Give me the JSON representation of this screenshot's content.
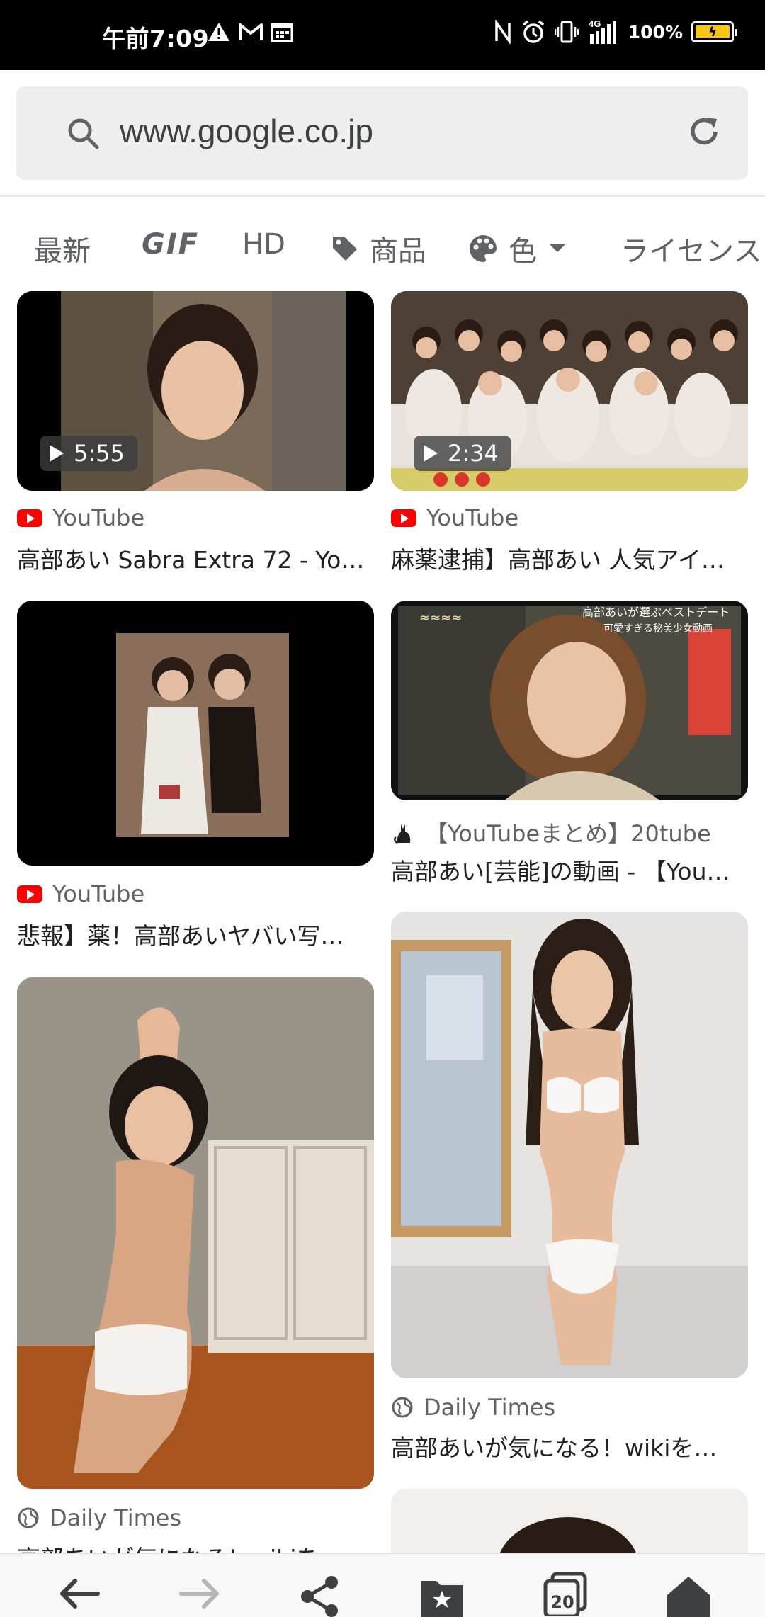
{
  "status_bar": {
    "time": "午前7:09",
    "network": "4G",
    "battery_pct": "100%",
    "battery_level": 1.0,
    "icons": [
      "warning-icon",
      "gmail-icon",
      "calendar-icon",
      "nfc-icon",
      "alarm-icon",
      "vibrate-icon",
      "signal-icon",
      "battery-icon"
    ]
  },
  "browser": {
    "url": "www.google.co.jp",
    "icons": [
      "search-icon",
      "reload-icon"
    ]
  },
  "filters": [
    {
      "label": "最新",
      "icon": ""
    },
    {
      "label": "GIF",
      "icon": ""
    },
    {
      "label": "HD",
      "icon": ""
    },
    {
      "label": "商品",
      "icon": "tag-icon"
    },
    {
      "label": "色",
      "icon": "palette-icon"
    },
    {
      "label": "ライセンス",
      "icon": ""
    }
  ],
  "results": [
    {
      "duration": "5:55",
      "source": "YouTube",
      "source_icon": "youtube-icon",
      "title": "高部あい Sabra Extra 72 - You…"
    },
    {
      "duration": "2:34",
      "source": "YouTube",
      "source_icon": "youtube-icon",
      "title": "麻薬逮捕】高部あい 人気アイ…"
    },
    {
      "duration": "",
      "source": "YouTube",
      "source_icon": "youtube-icon",
      "title": "悲報】薬！高部あいヤバい写…"
    },
    {
      "duration": "",
      "source": "【YouTubeまとめ】20tube",
      "source_icon": "cat-icon",
      "title": "高部あい[芸能]の動画 - 【You…",
      "overlay_line1": "高部あいが選ぶベストデート",
      "overlay_line2": "可愛すぎる秘美少女動画"
    },
    {
      "duration": "",
      "source": "Daily Times",
      "source_icon": "globe-icon",
      "title": "高部あいが気になる！wikiを…"
    },
    {
      "duration": "",
      "source": "Daily Times",
      "source_icon": "globe-icon",
      "title": "高部あいが気になる！wikiを…"
    }
  ],
  "bottom_nav": {
    "tab_count": "20",
    "icons": [
      "back-icon",
      "forward-icon",
      "share-icon",
      "bookmarks-icon",
      "tabs-icon",
      "home-icon"
    ]
  },
  "colors": {
    "status_bg": "#000000",
    "url_bar_bg": "#eeeeef",
    "youtube_red": "#ff0000",
    "battery_yellow": "#f5c518"
  }
}
